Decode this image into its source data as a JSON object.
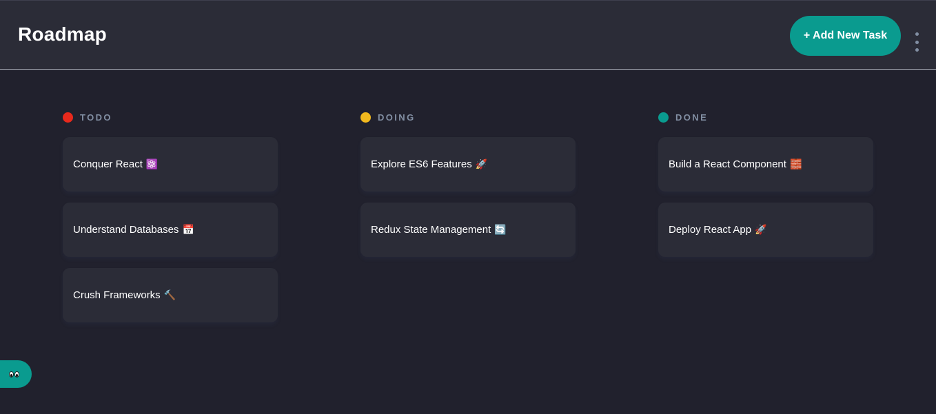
{
  "header": {
    "title": "Roadmap",
    "add_task_label": "+ Add New Task",
    "more_icon": "vertical-ellipsis-icon"
  },
  "colors": {
    "accent": "#0a9b8f",
    "todo": "#e8291c",
    "doing": "#f2b91e",
    "done": "#0a9b8f"
  },
  "columns": [
    {
      "title": "TODO",
      "cards": [
        {
          "title": "Conquer React",
          "emoji": "⚛️"
        },
        {
          "title": "Understand Databases",
          "emoji": "📅"
        },
        {
          "title": "Crush Frameworks",
          "emoji": "🔨"
        }
      ]
    },
    {
      "title": "DOING",
      "cards": [
        {
          "title": "Explore ES6 Features",
          "emoji": "🚀"
        },
        {
          "title": "Redux State Management",
          "emoji": "🔄"
        }
      ]
    },
    {
      "title": "DONE",
      "cards": [
        {
          "title": "Build a React Component",
          "emoji": "🧱"
        },
        {
          "title": "Deploy React App",
          "emoji": "🚀"
        }
      ]
    }
  ],
  "show_sidebar_icon": "eyes-icon"
}
